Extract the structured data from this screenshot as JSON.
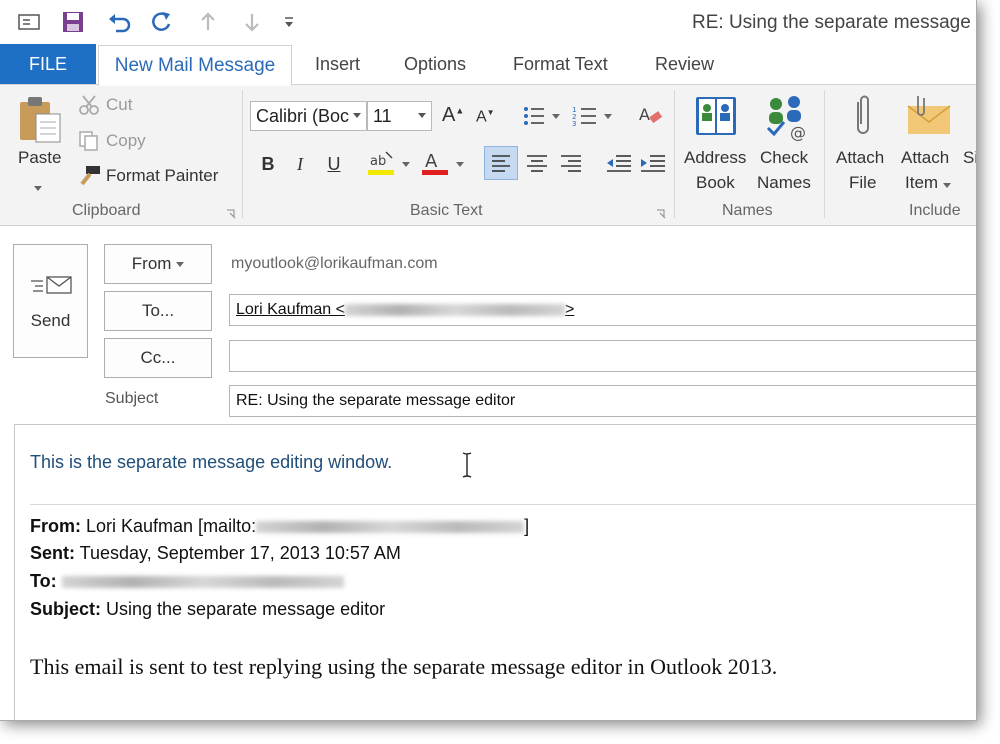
{
  "window": {
    "title": "RE: Using the separate message editi"
  },
  "qat": {
    "icons": [
      "mail-icon",
      "save-icon",
      "undo-icon",
      "redo-icon",
      "up-arrow-icon",
      "down-arrow-icon",
      "customize-icon"
    ]
  },
  "tabs": [
    {
      "label": "FILE"
    },
    {
      "label": "New Mail Message"
    },
    {
      "label": "Insert"
    },
    {
      "label": "Options"
    },
    {
      "label": "Format Text"
    },
    {
      "label": "Review"
    }
  ],
  "ribbon": {
    "clipboard": {
      "paste": "Paste",
      "cut": "Cut",
      "copy": "Copy",
      "format_painter": "Format Painter",
      "group": "Clipboard"
    },
    "basic_text": {
      "font_name": "Calibri (Boc",
      "font_size": "11",
      "bold": "B",
      "italic": "I",
      "underline": "U",
      "group": "Basic Text"
    },
    "names": {
      "address": "Address",
      "book": "Book",
      "check": "Check",
      "names_label": "Names",
      "group": "Names"
    },
    "include": {
      "attach_file_1": "Attach",
      "attach_file_2": "File",
      "attach_item_1": "Attach",
      "attach_item_2": "Item",
      "sig_partial": "Si",
      "group": "Include"
    }
  },
  "header": {
    "send": "Send",
    "from_btn": "From",
    "from_value": "myoutlook@lorikaufman.com",
    "to_btn": "To...",
    "to_value_prefix": "Lori Kaufman <",
    "to_value_suffix": ">",
    "cc_btn": "Cc...",
    "cc_value": "",
    "subject_label": "Subject",
    "subject_value": "RE: Using the separate message editor"
  },
  "body": {
    "reply_text": "This is the separate message editing window.",
    "from_label": "From:",
    "from_value": " Lori Kaufman [mailto:",
    "from_end": "]",
    "sent_label": "Sent:",
    "sent_value": " Tuesday, September 17, 2013 10:57 AM",
    "to_label": "To:",
    "subject_label": "Subject:",
    "subject_value": " Using the separate message editor",
    "message": "This email is sent to test replying using the separate message editor in Outlook 2013."
  },
  "colors": {
    "accent": "#1e6fc6",
    "tab_text": "#2a6ab8",
    "reply_text": "#1f4e79"
  }
}
